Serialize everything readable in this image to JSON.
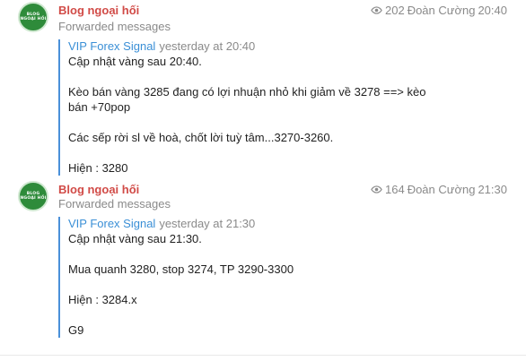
{
  "messages": [
    {
      "avatar": {
        "line1": "BLOG",
        "line2": "NGOẠI HỐI"
      },
      "sender": "Blog ngoại hối",
      "forwarded_label": "Forwarded messages",
      "views": "202",
      "author": "Đoàn Cường",
      "time": "20:40",
      "forward": {
        "from": "VIP Forex Signal",
        "when": "yesterday at 20:40",
        "lines": [
          "Cập nhật vàng sau 20:40.",
          "",
          "Kèo bán vàng 3285 đang có lợi nhuận nhỏ khi giảm về 3278 ==> kèo",
          "bán +70pop",
          "",
          "Các sếp rời sl về hoà, chốt lời tuỳ tâm...3270-3260.",
          "",
          "Hiện : 3280"
        ]
      }
    },
    {
      "avatar": {
        "line1": "BLOG",
        "line2": "NGOẠI HỐI"
      },
      "sender": "Blog ngoại hối",
      "forwarded_label": "Forwarded messages",
      "views": "164",
      "author": "Đoàn Cường",
      "time": "21:30",
      "forward": {
        "from": "VIP Forex Signal",
        "when": "yesterday at 21:30",
        "lines": [
          "Cập nhật vàng sau 21:30.",
          "",
          "Mua quanh 3280, stop 3274, TP 3290-3300",
          "",
          "Hiện : 3284.x",
          "",
          "G9"
        ]
      }
    }
  ],
  "colors": {
    "sender": "#d14b47",
    "forward_name": "#3a8fd6",
    "forward_bar": "#4a90d9",
    "meta": "#8a8a8a",
    "avatar_bg": "#2e8b3a"
  },
  "icons": {
    "views": "eye-icon"
  }
}
